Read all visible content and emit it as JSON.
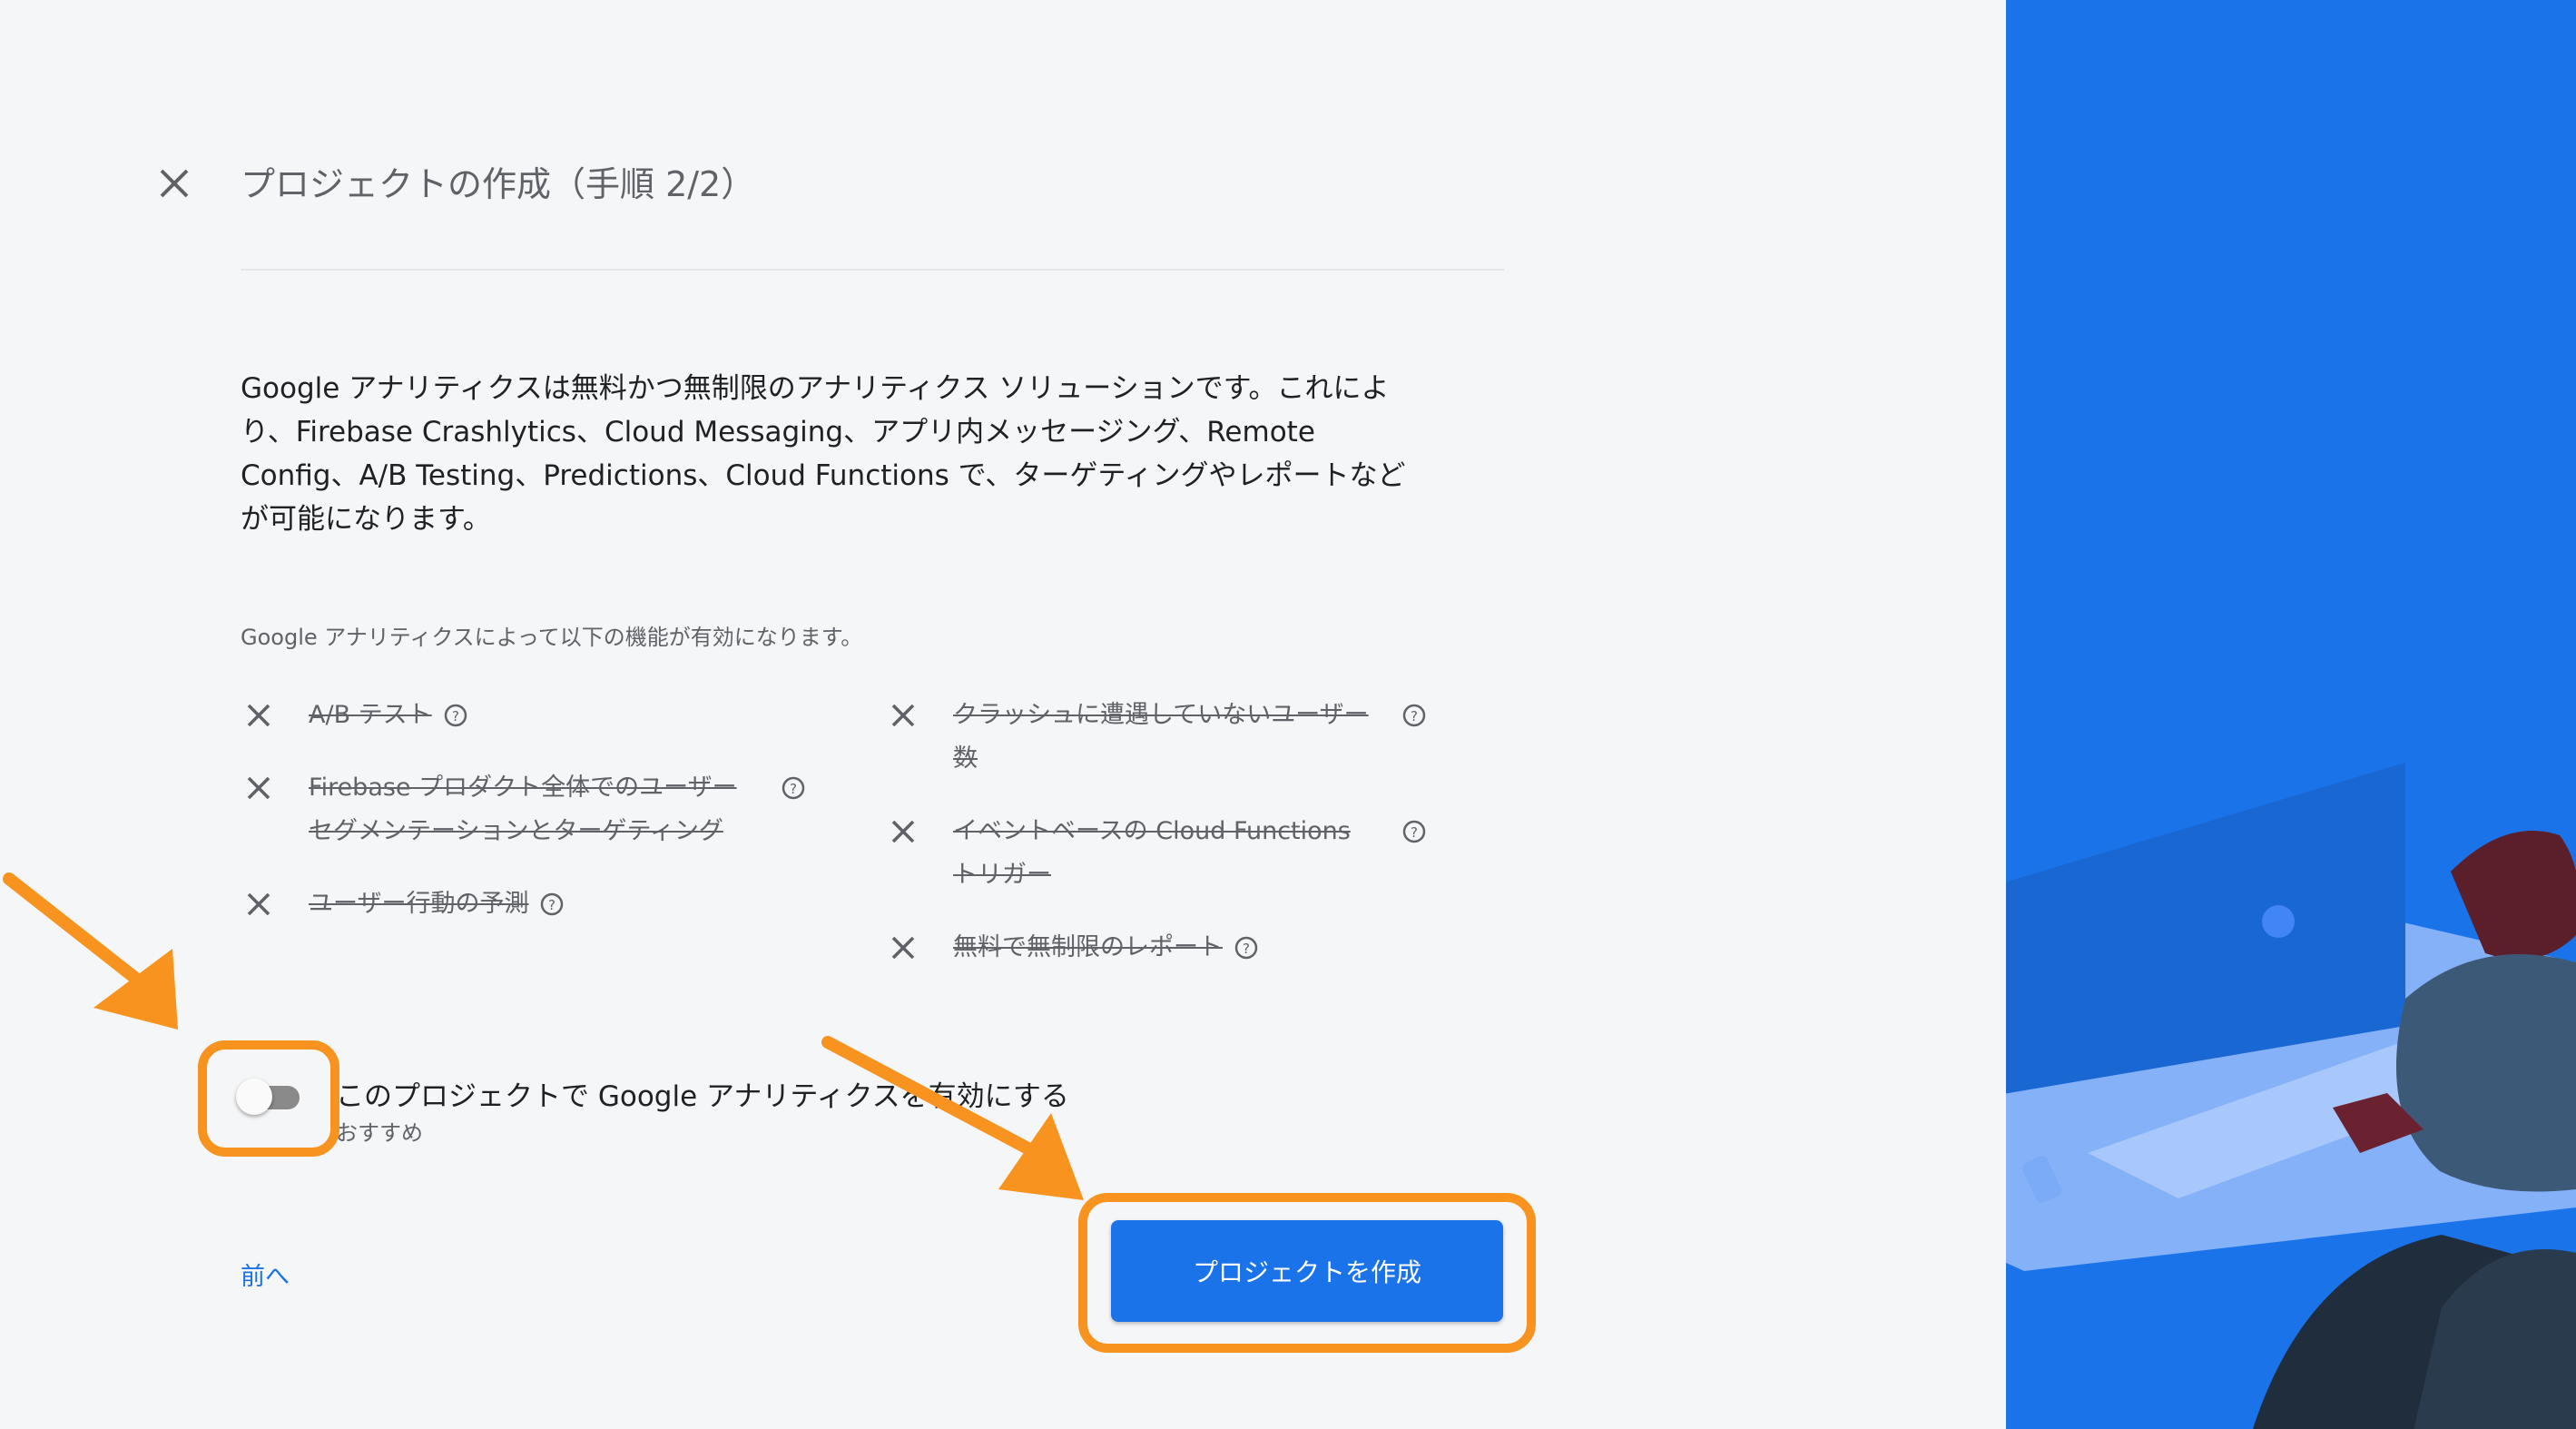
{
  "dialog": {
    "title": "プロジェクトの作成（手順 2/2）",
    "description": "Google アナリティクスは無料かつ無制限のアナリティクス ソリューションです。これにより、Firebase Crashlytics、Cloud Messaging、アプリ内メッセージング、Remote Config、A/B Testing、Predictions、Cloud Functions で、ターゲティングやレポートなどが可能になります。",
    "features_heading": "Google アナリティクスによって以下の機能が有効になります。",
    "features_left": [
      {
        "label": "A/B テスト",
        "enabled": false
      },
      {
        "label": "Firebase プロダクト全体でのユーザー セグメンテーションとターゲティング",
        "enabled": false
      },
      {
        "label": "ユーザー行動の予測",
        "enabled": false
      }
    ],
    "features_right": [
      {
        "label": "クラッシュに遭遇していないユーザー数",
        "enabled": false
      },
      {
        "label": "イベントベースの Cloud Functions トリガー",
        "enabled": false
      },
      {
        "label": "無料で無制限のレポート",
        "enabled": false
      }
    ],
    "analytics_toggle": {
      "label": "このプロジェクトで Google アナリティクスを有効にする",
      "sublabel": "おすすめ",
      "on": false
    },
    "back_label": "前へ",
    "create_label": "プロジェクトを作成"
  },
  "colors": {
    "primary": "#1a73e8",
    "highlight": "#f7931e",
    "background": "#f5f6f7"
  },
  "icons": [
    "close-icon",
    "x-icon",
    "help-icon",
    "arrow-icon"
  ]
}
